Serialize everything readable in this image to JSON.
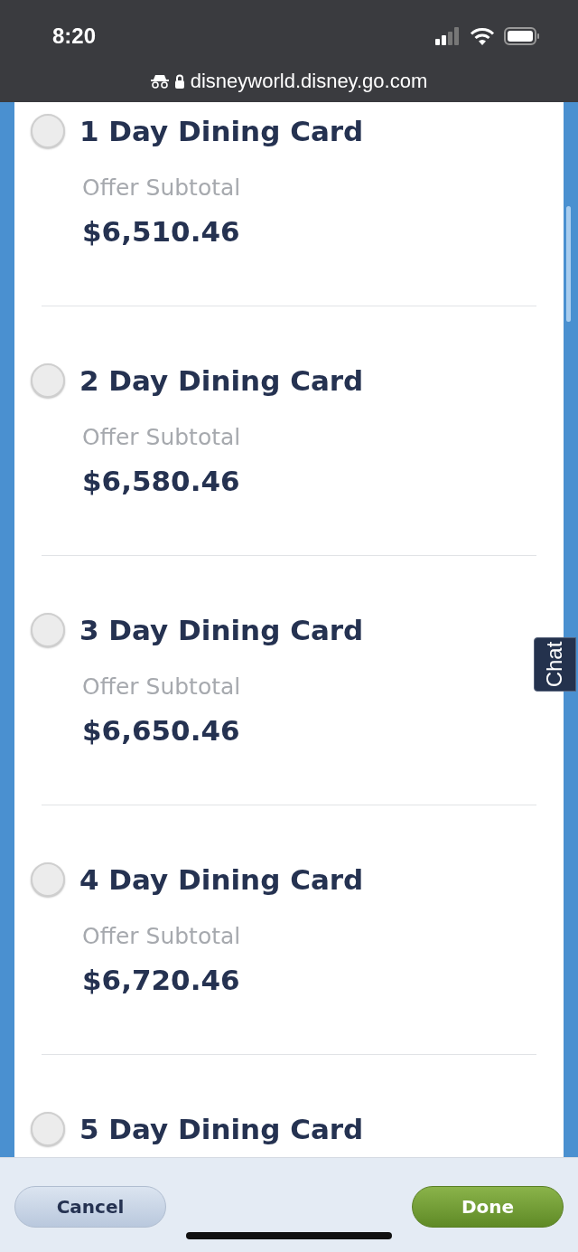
{
  "status_bar": {
    "time": "8:20"
  },
  "address_bar": {
    "url": "disneyworld.disney.go.com"
  },
  "options": [
    {
      "title": "1 Day Dining Card",
      "label": "Offer Subtotal",
      "price": "$6,510.46",
      "selected": false
    },
    {
      "title": "2 Day Dining Card",
      "label": "Offer Subtotal",
      "price": "$6,580.46",
      "selected": false
    },
    {
      "title": "3 Day Dining Card",
      "label": "Offer Subtotal",
      "price": "$6,650.46",
      "selected": false
    },
    {
      "title": "4 Day Dining Card",
      "label": "Offer Subtotal",
      "price": "$6,720.46",
      "selected": false
    },
    {
      "title": "5 Day Dining Card",
      "selected": false
    }
  ],
  "chat_tab": {
    "label": "Chat"
  },
  "footer": {
    "cancel": "Cancel",
    "done": "Done"
  }
}
